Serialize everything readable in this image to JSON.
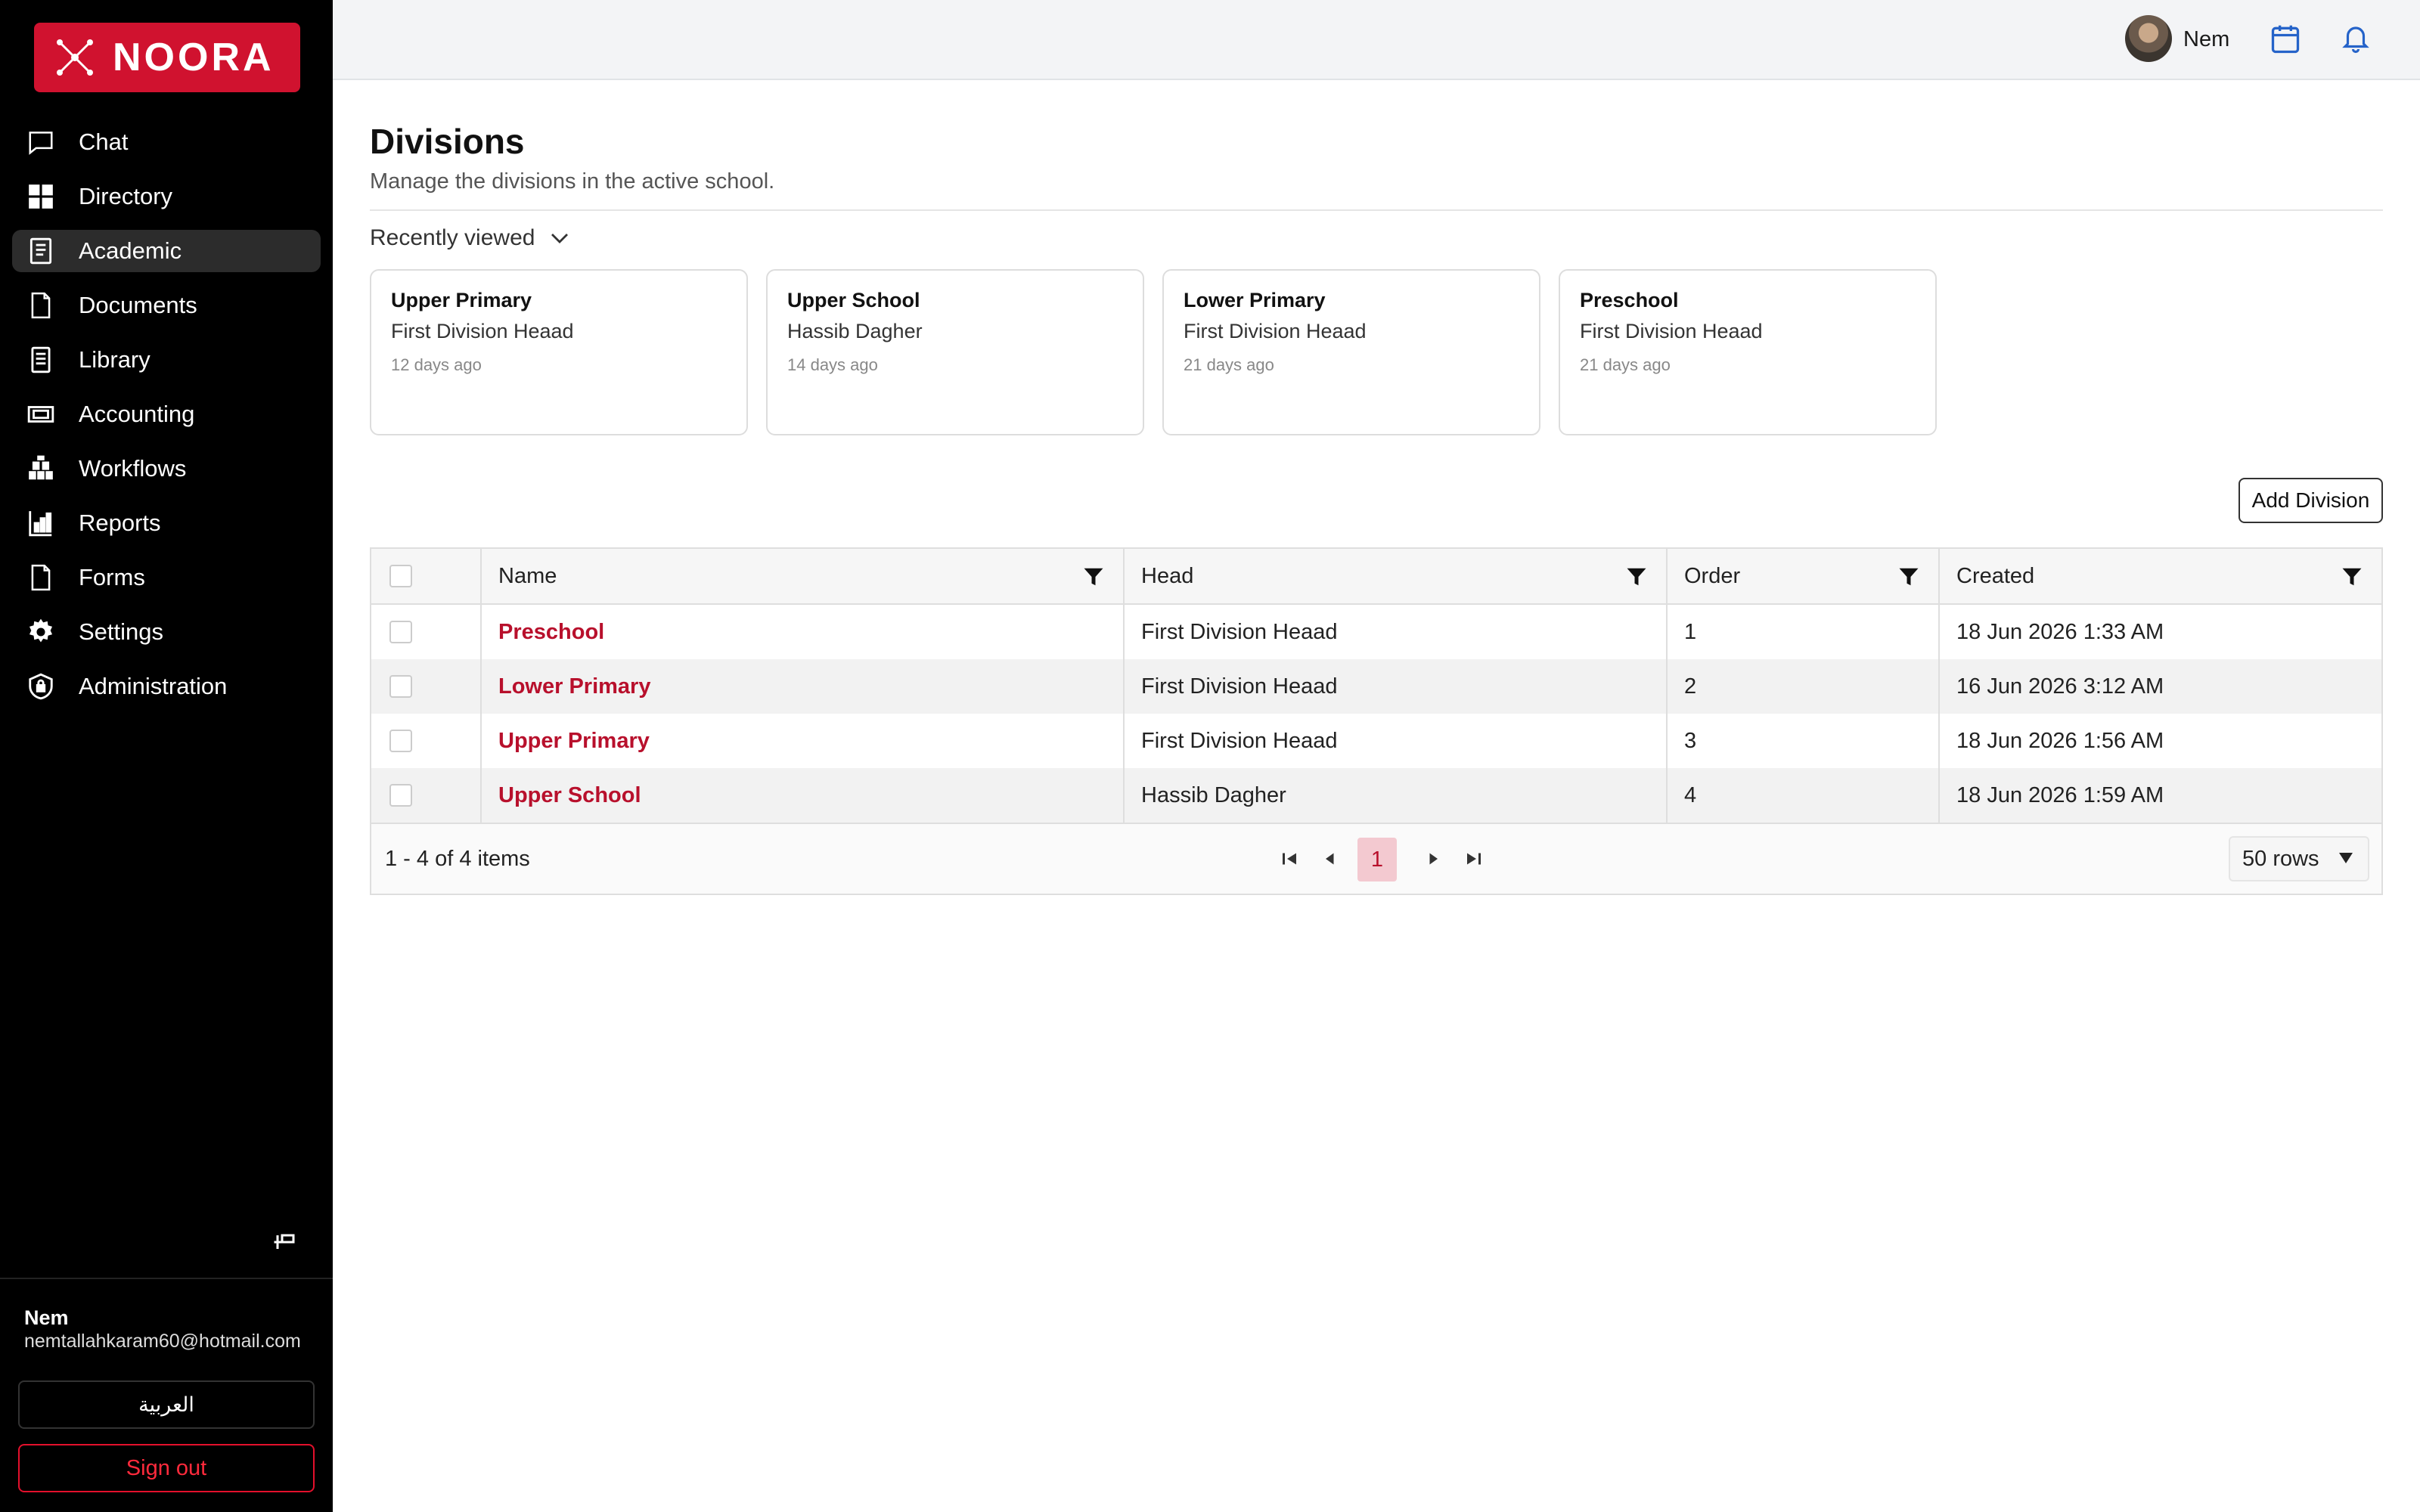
{
  "app": {
    "brand": "NOORA",
    "brand_color": "#d0122f",
    "accent_link": "#b8102c"
  },
  "sidebar": {
    "items": [
      {
        "label": "Chat",
        "icon": "chat-icon",
        "active": false
      },
      {
        "label": "Directory",
        "icon": "grid-icon",
        "active": false
      },
      {
        "label": "Academic",
        "icon": "academic-book-icon",
        "active": true
      },
      {
        "label": "Documents",
        "icon": "document-icon",
        "active": false
      },
      {
        "label": "Library",
        "icon": "library-icon",
        "active": false
      },
      {
        "label": "Accounting",
        "icon": "money-icon",
        "active": false
      },
      {
        "label": "Workflows",
        "icon": "workflows-icon",
        "active": false
      },
      {
        "label": "Reports",
        "icon": "reports-icon",
        "active": false
      },
      {
        "label": "Forms",
        "icon": "forms-icon",
        "active": false
      },
      {
        "label": "Settings",
        "icon": "gear-icon",
        "active": false
      },
      {
        "label": "Administration",
        "icon": "shield-lock-icon",
        "active": false
      }
    ],
    "user": {
      "name": "Nem",
      "email": "nemtallahkaram60@hotmail.com"
    },
    "language_button": "العربية",
    "signout_button": "Sign out"
  },
  "topbar": {
    "user_name": "Nem"
  },
  "page": {
    "title": "Divisions",
    "subtitle": "Manage the divisions in the active school.",
    "recent_label": "Recently viewed",
    "add_button": "Add Division"
  },
  "recent": [
    {
      "title": "Upper Primary",
      "head": "First Division Heaad",
      "time": "12 days ago"
    },
    {
      "title": "Upper School",
      "head": "Hassib Dagher",
      "time": "14 days ago"
    },
    {
      "title": "Lower Primary",
      "head": "First Division Heaad",
      "time": "21 days ago"
    },
    {
      "title": "Preschool",
      "head": "First Division Heaad",
      "time": "21 days ago"
    }
  ],
  "table": {
    "columns": [
      "Name",
      "Head",
      "Order",
      "Created"
    ],
    "rows": [
      {
        "name": "Preschool",
        "head": "First Division Heaad",
        "order": "1",
        "created": "18 Jun 2026 1:33 AM"
      },
      {
        "name": "Lower Primary",
        "head": "First Division Heaad",
        "order": "2",
        "created": "16 Jun 2026 3:12 AM"
      },
      {
        "name": "Upper Primary",
        "head": "First Division Heaad",
        "order": "3",
        "created": "18 Jun 2026 1:56 AM"
      },
      {
        "name": "Upper School",
        "head": "Hassib Dagher",
        "order": "4",
        "created": "18 Jun 2026 1:59 AM"
      }
    ],
    "pager": {
      "info": "1 - 4 of 4 items",
      "current_page": "1",
      "rows_per_page": "50 rows"
    }
  }
}
